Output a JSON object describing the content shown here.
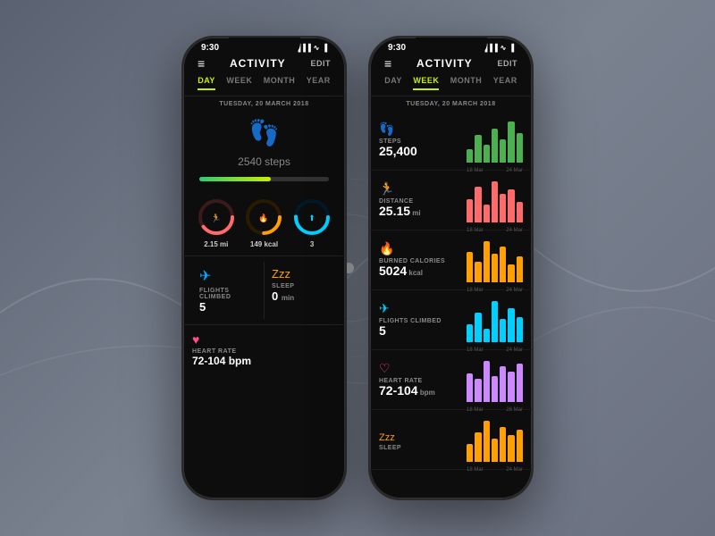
{
  "background": {
    "color": "#6b7280"
  },
  "phone1": {
    "statusBar": {
      "time": "9:30",
      "signal": "▐▐▐",
      "wifi": "WiFi",
      "battery": "🔋"
    },
    "header": {
      "menu": "≡",
      "title": "ACTIVITY",
      "edit": "EDIT"
    },
    "tabs": [
      {
        "label": "DAY",
        "active": true
      },
      {
        "label": "WEEK",
        "active": false
      },
      {
        "label": "MONTH",
        "active": false
      },
      {
        "label": "YEAR",
        "active": false
      }
    ],
    "date": "TUESDAY, 20 MARCH 2018",
    "hero": {
      "steps": "2540",
      "stepsLabel": "steps",
      "progressPct": 55
    },
    "rings": [
      {
        "label": "2.15 mi",
        "color": "#ff6b6b",
        "bgColor": "#3a1a1a",
        "pct": 65,
        "icon": "🏃"
      },
      {
        "label": "149 kcal",
        "color": "#ff9f00",
        "bgColor": "#2a1a00",
        "pct": 50,
        "icon": "🔥"
      },
      {
        "label": "3",
        "color": "#00cfff",
        "bgColor": "#001a2a",
        "pct": 75,
        "icon": "⬆"
      }
    ],
    "statCards": [
      {
        "icon": "✈",
        "iconColor": "#00aaff",
        "name": "FLIGHTS CLIMBED",
        "value": "5",
        "unit": ""
      },
      {
        "icon": "Zzz",
        "iconColor": "#ff9f00",
        "name": "SLEEP",
        "value": "0",
        "unit": "min"
      }
    ],
    "heartRate": {
      "icon": "♥",
      "name": "HEART RATE",
      "value": "72-104 bpm"
    }
  },
  "phone2": {
    "statusBar": {
      "time": "9:30"
    },
    "header": {
      "menu": "≡",
      "title": "ACTIVITY",
      "edit": "EDIT"
    },
    "tabs": [
      {
        "label": "DAY",
        "active": false
      },
      {
        "label": "WEEK",
        "active": true
      },
      {
        "label": "MONTH",
        "active": false
      },
      {
        "label": "YEAR",
        "active": false
      }
    ],
    "date": "TUESDAY, 20 MARCH 2018",
    "weekStats": [
      {
        "icon": "👣",
        "iconColor": "#4CAF50",
        "name": "STEPS",
        "value": "25,400",
        "unit": "",
        "chartColor": "#4CAF50",
        "bars": [
          30,
          60,
          40,
          75,
          50,
          90,
          65
        ],
        "labelStart": "18 Mar",
        "labelEnd": "24 Mar"
      },
      {
        "icon": "🏃",
        "iconColor": "#ff6b6b",
        "name": "DISTANCE",
        "value": "25.15",
        "unit": "mi",
        "chartColor": "#ff6b6b",
        "bars": [
          45,
          70,
          35,
          80,
          55,
          65,
          40
        ],
        "labelStart": "18 Mar",
        "labelEnd": "24 Mar"
      },
      {
        "icon": "🔥",
        "iconColor": "#ff9f00",
        "name": "BURNED CALORIES",
        "value": "5024",
        "unit": "kcal",
        "chartColor": "#ff9f00",
        "bars": [
          60,
          40,
          80,
          55,
          70,
          35,
          50
        ],
        "labelStart": "18 Mar",
        "labelEnd": "24 Mar"
      },
      {
        "icon": "✈",
        "iconColor": "#00cfff",
        "name": "FLIGHTS CLIMBED",
        "value": "5",
        "unit": "",
        "chartColor": "#00cfff",
        "bars": [
          40,
          65,
          30,
          90,
          50,
          75,
          55
        ],
        "labelStart": "18 Mar",
        "labelEnd": "24 Mar"
      },
      {
        "icon": "♥",
        "iconColor": "#ff4d8d",
        "name": "HEART RATE",
        "value": "72-104",
        "unit": "bpm",
        "chartColor": "#cc88ff",
        "bars": [
          55,
          45,
          80,
          50,
          70,
          60,
          75
        ],
        "labelStart": "18 Mar",
        "labelEnd": "26 Mar"
      },
      {
        "icon": "Zzz",
        "iconColor": "#ff9f00",
        "name": "SLEEP",
        "value": "",
        "unit": "",
        "chartColor": "#ff9f00",
        "bars": [
          30,
          50,
          70,
          40,
          60,
          45,
          55
        ],
        "labelStart": "18 Mar",
        "labelEnd": "24 Mar"
      }
    ]
  }
}
